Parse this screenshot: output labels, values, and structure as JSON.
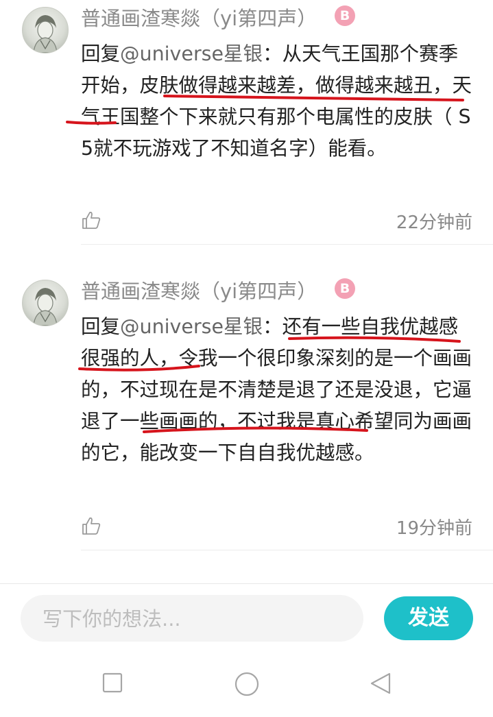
{
  "comments": [
    {
      "username": "普通画渣寒燚（yi第四声）",
      "badge": "B",
      "reply_prefix": "回复",
      "mention": "@universe星银",
      "colon": "：",
      "text": "从天气王国那个赛季开始，皮肤做得越来越差，做得越来越丑，天气王国整个下来就只有那个电属性的皮肤（ S5就不玩游戏了不知道名字）能看。",
      "time": "22分钟前"
    },
    {
      "username": "普通画渣寒燚（yi第四声）",
      "badge": "B",
      "reply_prefix": "回复",
      "mention": "@universe星银",
      "colon": "：",
      "text": "还有一些自我优越感很强的人，令我一个很印象深刻的是一个画画的，不过现在是不清楚是退了还是没退，它逼退了一些画画的，不过我是真心希望同为画画的它，能改变一下自自我优越感。",
      "time": "19分钟前"
    }
  ],
  "input": {
    "placeholder": "写下你的想法..."
  },
  "send_label": "发送",
  "icons": {
    "like": "thumbs-up-icon",
    "badge": "b-badge-icon",
    "nav_recent": "square-icon",
    "nav_home": "circle-icon",
    "nav_back": "triangle-back-icon"
  },
  "colors": {
    "accent": "#1ec0c9",
    "annotation": "#d6141c",
    "badge": "#f3a1b4"
  }
}
